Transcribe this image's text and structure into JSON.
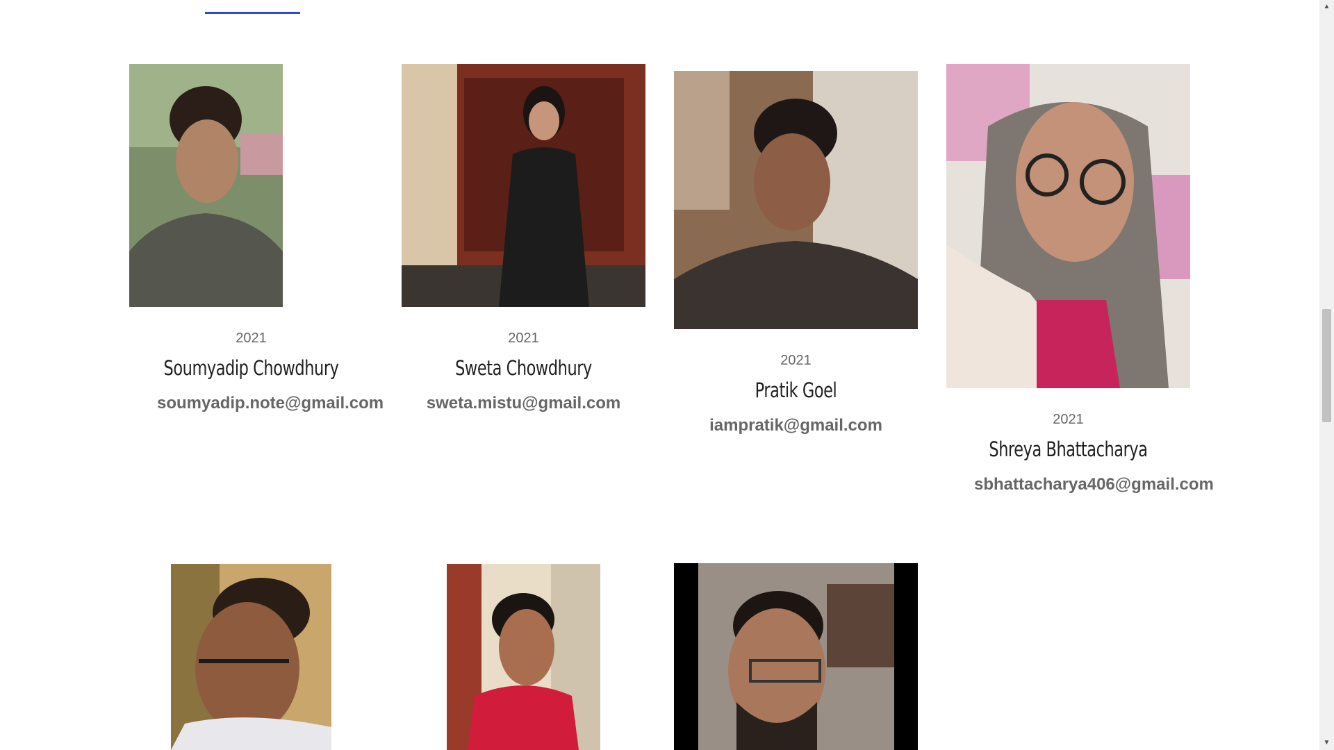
{
  "members": [
    {
      "year": "2021",
      "name": "Soumyadip Chowdhury",
      "email": "soumyadip.note@gmail.com"
    },
    {
      "year": "2021",
      "name": "Sweta Chowdhury",
      "email": "sweta.mistu@gmail.com"
    },
    {
      "year": "2021",
      "name": "Pratik Goel",
      "email": "iampratik@gmail.com"
    },
    {
      "year": "2021",
      "name": "Shreya Bhattacharya",
      "email": "sbhattacharya406@gmail.com"
    }
  ],
  "scrollbar": {
    "up_icon": "▲",
    "down_icon": "▼"
  },
  "colors": {
    "accent": "#2f4bd6",
    "muted_text": "#666666",
    "name_text": "#1f1f1f"
  }
}
